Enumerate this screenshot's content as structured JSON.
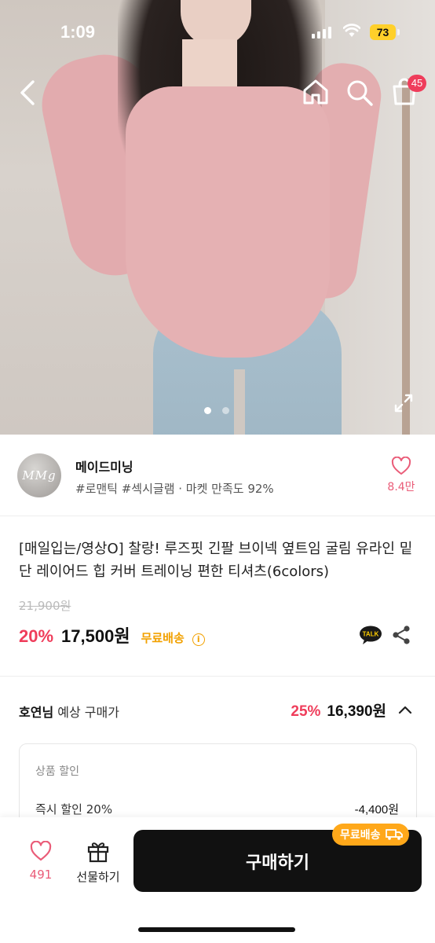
{
  "status_bar": {
    "time": "1:09",
    "battery": "73"
  },
  "nav": {
    "cart_count": "45"
  },
  "store": {
    "logo_text": "MMg",
    "name": "메이드미닝",
    "tags": "#로맨틱 #섹시글램 · 마켓 만족도 92%",
    "likes": "8.4만"
  },
  "product": {
    "title": "[매일입는/영상O] 찰랑! 루즈핏 긴팔 브이넥 옆트임 굴림 유라인 밑단 레이어드 힙 커버 트레이닝 편한 티셔츠(6colors)",
    "original_price": "21,900원",
    "discount": "20%",
    "price": "17,500원",
    "shipping": "무료배송",
    "talk_label": "TALK"
  },
  "estimate": {
    "user": "호연님",
    "label": "예상 구매가",
    "discount": "25%",
    "price": "16,390원"
  },
  "breakdown": {
    "heading": "상품 할인",
    "rows": [
      {
        "label": "즉시 할인 20%",
        "value": "-4,400원"
      }
    ]
  },
  "bottom_bar": {
    "likes": "491",
    "gift_label": "선물하기",
    "buy_label": "구매하기",
    "ship_chip": "무료배송"
  },
  "colors": {
    "accent": "#ef3d5b",
    "free_shipping": "#f2a100",
    "buy_button": "#111111"
  },
  "icons": [
    "back-icon",
    "home-icon",
    "search-icon",
    "cart-icon",
    "expand-icon",
    "heart-icon",
    "talk-icon",
    "share-icon",
    "chevron-up-icon",
    "gift-icon",
    "truck-icon"
  ]
}
